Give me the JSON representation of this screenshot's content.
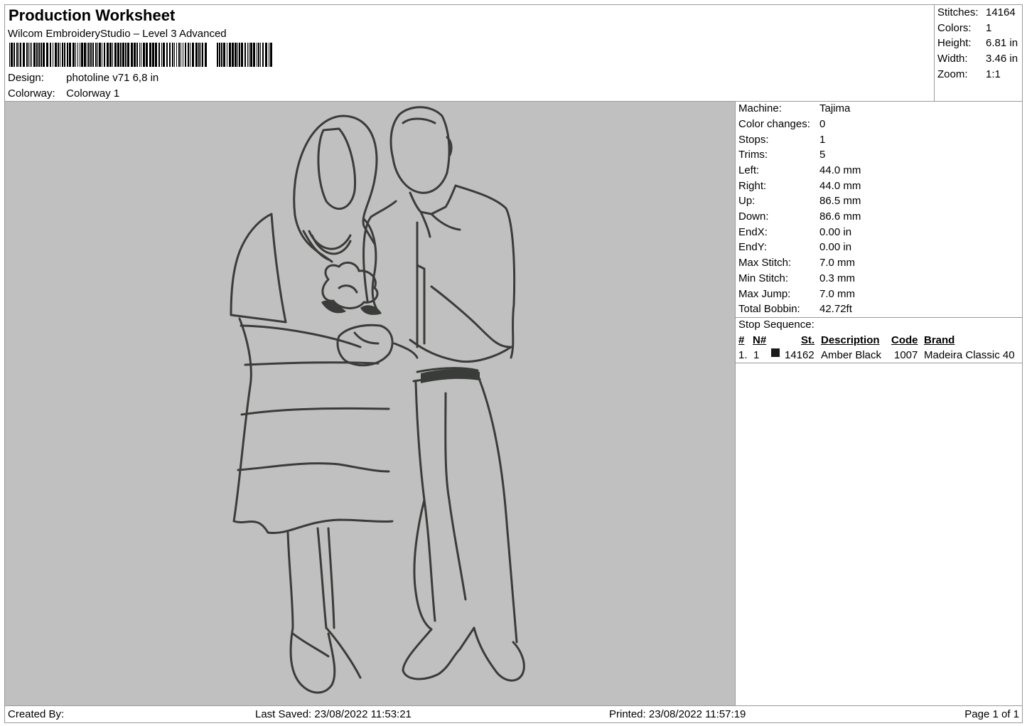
{
  "header": {
    "title": "Production Worksheet",
    "software": "Wilcom EmbroideryStudio – Level 3 Advanced",
    "design_label": "Design:",
    "design_value": "photoline v71 6,8 in",
    "colorway_label": "Colorway:",
    "colorway_value": "Colorway 1"
  },
  "summary": [
    {
      "label": "Stitches:",
      "value": "14164"
    },
    {
      "label": "Colors:",
      "value": "1"
    },
    {
      "label": "Height:",
      "value": "6.81 in"
    },
    {
      "label": "Width:",
      "value": "3.46 in"
    },
    {
      "label": "Zoom:",
      "value": "1:1"
    }
  ],
  "details": [
    {
      "label": "Machine:",
      "value": "Tajima"
    },
    {
      "label": "Color changes:",
      "value": "0"
    },
    {
      "label": "Stops:",
      "value": "1"
    },
    {
      "label": "Trims:",
      "value": "5"
    },
    {
      "label": "Left:",
      "value": "44.0 mm"
    },
    {
      "label": "Right:",
      "value": "44.0 mm"
    },
    {
      "label": "Up:",
      "value": "86.5 mm"
    },
    {
      "label": "Down:",
      "value": "86.6 mm"
    },
    {
      "label": "EndX:",
      "value": "0.00 in"
    },
    {
      "label": "EndY:",
      "value": "0.00 in"
    },
    {
      "label": "Max Stitch:",
      "value": "7.0 mm"
    },
    {
      "label": "Min Stitch:",
      "value": "0.3 mm"
    },
    {
      "label": "Max Jump:",
      "value": "7.0 mm"
    },
    {
      "label": "Total Bobbin:",
      "value": "42.72ft"
    }
  ],
  "stop_sequence": {
    "title": "Stop Sequence:",
    "headers": {
      "num": "#",
      "n": "N#",
      "st": "St.",
      "description": "Description",
      "code": "Code",
      "brand": "Brand"
    },
    "rows": [
      {
        "num": "1.",
        "n": "1",
        "swatch": "#1a1a1a",
        "st": "14162",
        "description": "Amber Black",
        "code": "1007",
        "brand": "Madeira Classic 40"
      }
    ]
  },
  "footer": {
    "created_by": "Created By:",
    "last_saved": "Last Saved: 23/08/2022 11:53:21",
    "printed": "Printed: 23/08/2022 11:57:19",
    "page": "Page 1 of 1"
  },
  "colors": {
    "preview_bg": "#c0c0c0",
    "stitch": "#3a3c39",
    "border": "#9a9a9a"
  }
}
